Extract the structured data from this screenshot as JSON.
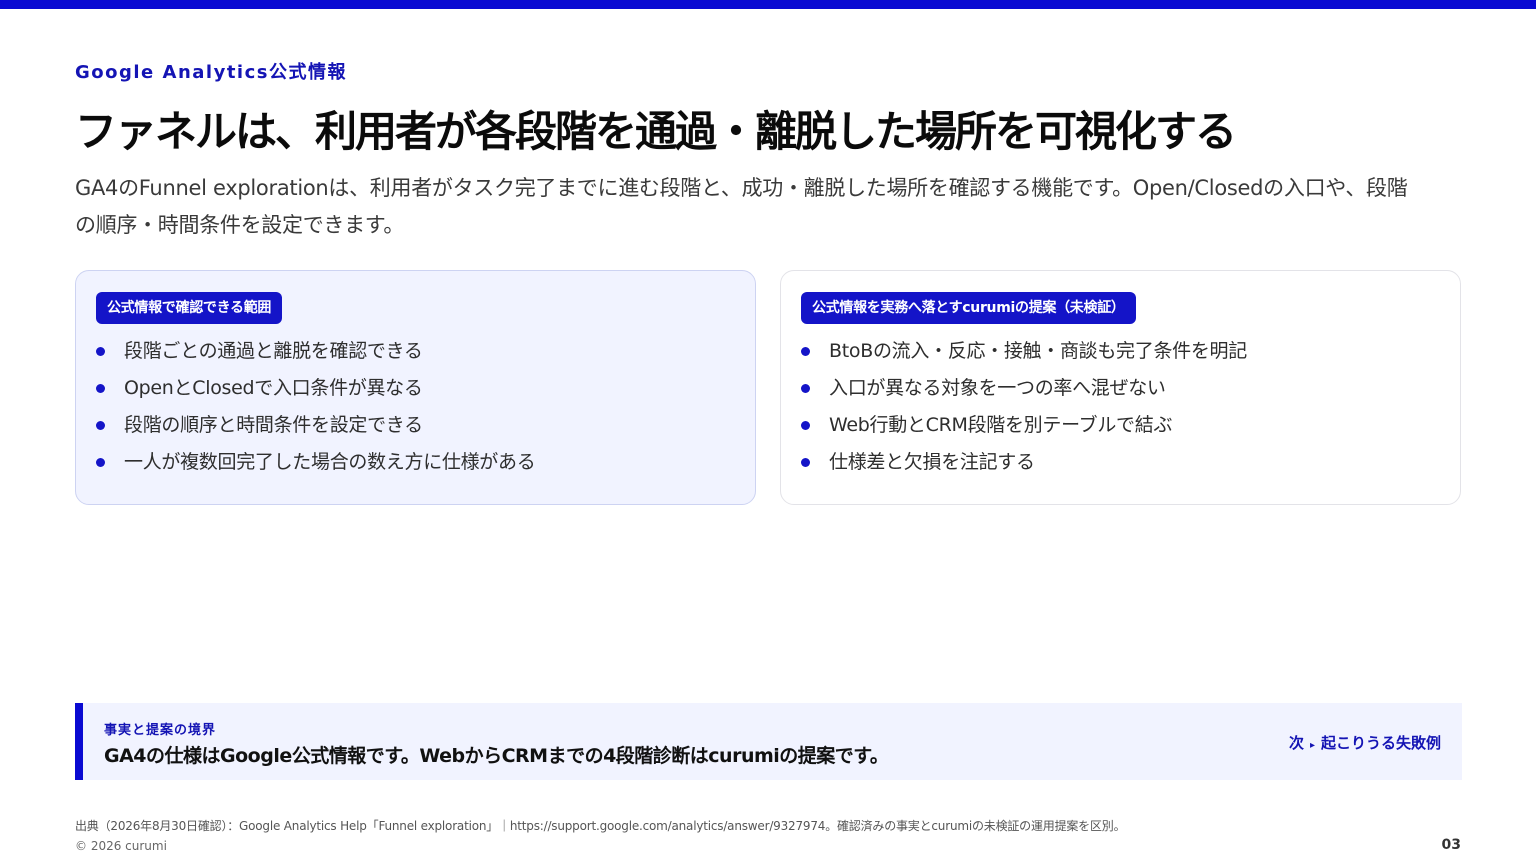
{
  "colors": {
    "accent": "#0a0ad2",
    "accent_text": "#1414b4",
    "card_tint": "#f1f3ff"
  },
  "header": {
    "eyebrow": "Google Analytics公式情報",
    "title": "ファネルは、利用者が各段階を通過・離脱した場所を可視化する",
    "lead": "GA4のFunnel explorationは、利用者がタスク完了までに進む段階と、成功・離脱した場所を確認する機能です。Open/Closedの入口や、段階の順序・時間条件を設定できます。"
  },
  "cards": {
    "left": {
      "tag": "公式情報で確認できる範囲",
      "items": [
        "段階ごとの通過と離脱を確認できる",
        "OpenとClosedで入口条件が異なる",
        "段階の順序と時間条件を設定できる",
        "一人が複数回完了した場合の数え方に仕様がある"
      ]
    },
    "right": {
      "tag": "公式情報を実務へ落とすcurumiの提案（未検証）",
      "items": [
        "BtoBの流入・反応・接触・商談も完了条件を明記",
        "入口が異なる対象を一つの率へ混ぜない",
        "Web行動とCRM段階を別テーブルで結ぶ",
        "仕様差と欠損を注記する"
      ]
    }
  },
  "boundary": {
    "label": "事実と提案の境界",
    "text": "GA4の仕様はGoogle公式情報です。WebからCRMまでの4段階診断はcurumiの提案です。",
    "next_prefix": "次",
    "next_arrow": "▸",
    "next_label": "起こりうる失敗例"
  },
  "footer": {
    "source": "出典（2026年8月30日確認）：Google Analytics Help「Funnel exploration」｜https://support.google.com/analytics/answer/9327974。確認済みの事実とcurumiの未検証の運用提案を区別。",
    "copyright": "© 2026 curumi",
    "page_number": "03"
  }
}
